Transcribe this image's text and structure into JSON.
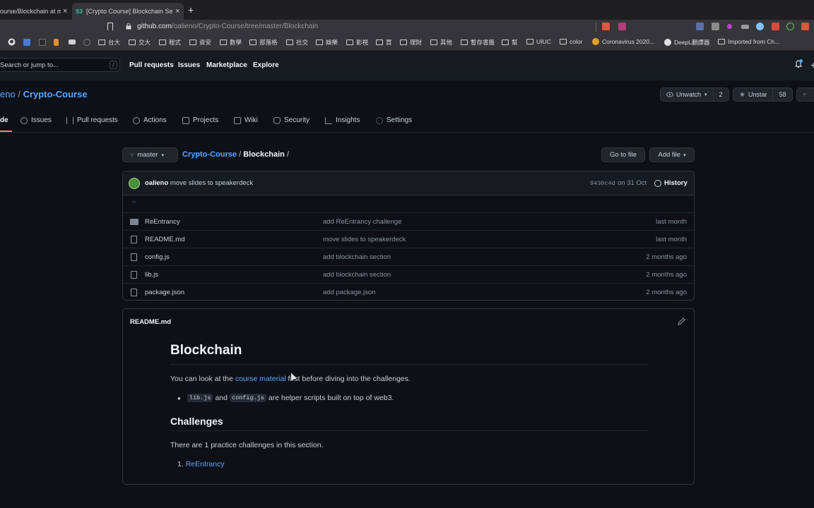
{
  "browser": {
    "tabs": [
      {
        "title": "ourse/Blockchain at m"
      },
      {
        "title": "[Crypto Course] Blockchain Sec"
      }
    ],
    "tab_favicon_text": "S3",
    "url_host": "github.com",
    "url_path": "/oalieno/Crypto-Course/tree/master/Blockchain",
    "bookmarks": [
      {
        "label": "台大"
      },
      {
        "label": "交大"
      },
      {
        "label": "程式"
      },
      {
        "label": "資安"
      },
      {
        "label": "數學"
      },
      {
        "label": "部落格"
      },
      {
        "label": "社交"
      },
      {
        "label": "娛樂"
      },
      {
        "label": "影視"
      },
      {
        "label": "買"
      },
      {
        "label": "理財"
      },
      {
        "label": "其他"
      },
      {
        "label": "暫存書籤"
      },
      {
        "label": "幫"
      },
      {
        "label": "UIUC"
      },
      {
        "label": "color"
      },
      {
        "label": "Coronavirus 2020..."
      },
      {
        "label": "DeepL翻譯器"
      },
      {
        "label": "Imported from Ch..."
      }
    ]
  },
  "header": {
    "search_placeholder": "Search or jump to...",
    "search_shortcut": "/",
    "nav": [
      "Pull requests",
      "Issues",
      "Marketplace",
      "Explore"
    ]
  },
  "repo": {
    "owner": "eno",
    "name": "Crypto-Course",
    "watch_label": "Unwatch",
    "watch_count": "2",
    "star_label": "Unstar",
    "star_count": "58",
    "tabs": [
      "de",
      "Issues",
      "Pull requests",
      "Actions",
      "Projects",
      "Wiki",
      "Security",
      "Insights",
      "Settings"
    ]
  },
  "browser_path": {
    "branch": "master",
    "root": "Crypto-Course",
    "folder": "Blockchain",
    "go_to_file": "Go to file",
    "add_file": "Add file"
  },
  "commit": {
    "author": "oalieno",
    "message": "move slides to speakerdeck",
    "sha": "9430c4d",
    "date": "on 31 Oct",
    "history": "History"
  },
  "files": [
    {
      "name": "ReEntrancy",
      "type": "dir",
      "message": "add ReEntrancy challenge",
      "age": "last month"
    },
    {
      "name": "README.md",
      "type": "file",
      "message": "move slides to speakerdeck",
      "age": "last month"
    },
    {
      "name": "config.js",
      "type": "file",
      "message": "add blockchain section",
      "age": "2 months ago"
    },
    {
      "name": "lib.js",
      "type": "file",
      "message": "add blockchain section",
      "age": "2 months ago"
    },
    {
      "name": "package.json",
      "type": "file",
      "message": "add package.json",
      "age": "2 months ago"
    }
  ],
  "parent_dir": "..",
  "readme": {
    "label": "README.md",
    "h1": "Blockchain",
    "p1_before": "You can look at the ",
    "p1_link": "course material",
    "p1_after": " first before diving into the challenges.",
    "bullet_code1": "lib.js",
    "bullet_and": "and",
    "bullet_code2": "config.js",
    "bullet_rest": "are helper scripts built on top of web3.",
    "h2": "Challenges",
    "p2": "There are 1 practice challenges in this section.",
    "list_num": "1.",
    "list_link": "ReEntrancy"
  }
}
